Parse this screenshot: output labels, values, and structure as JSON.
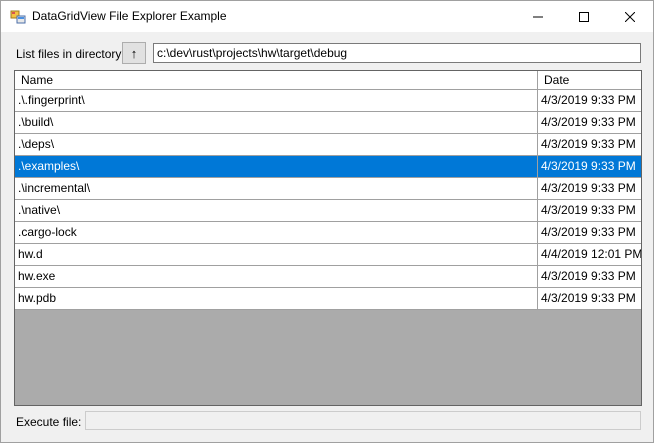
{
  "window": {
    "title": "DataGridView File Explorer Example"
  },
  "toolbar": {
    "list_label": "List files in directory:",
    "up_button_label": "↑",
    "path_value": "c:\\dev\\rust\\projects\\hw\\target\\debug"
  },
  "grid": {
    "columns": [
      "Name",
      "Date"
    ],
    "rows": [
      {
        "name": ".\\.fingerprint\\",
        "date": "4/3/2019 9:33 PM"
      },
      {
        "name": ".\\build\\",
        "date": "4/3/2019 9:33 PM"
      },
      {
        "name": ".\\deps\\",
        "date": "4/3/2019 9:33 PM"
      },
      {
        "name": ".\\examples\\",
        "date": "4/3/2019 9:33 PM"
      },
      {
        "name": ".\\incremental\\",
        "date": "4/3/2019 9:33 PM"
      },
      {
        "name": ".\\native\\",
        "date": "4/3/2019 9:33 PM"
      },
      {
        "name": ".cargo-lock",
        "date": "4/3/2019 9:33 PM"
      },
      {
        "name": "hw.d",
        "date": "4/4/2019 12:01 PM"
      },
      {
        "name": "hw.exe",
        "date": "4/3/2019 9:33 PM"
      },
      {
        "name": "hw.pdb",
        "date": "4/3/2019 9:33 PM"
      }
    ],
    "selected_index": 3
  },
  "footer": {
    "execute_label": "Execute file:",
    "execute_value": ""
  },
  "colors": {
    "selection": "#0078d7",
    "window_bg": "#f0f0f0",
    "grid_bg": "#ababab"
  }
}
